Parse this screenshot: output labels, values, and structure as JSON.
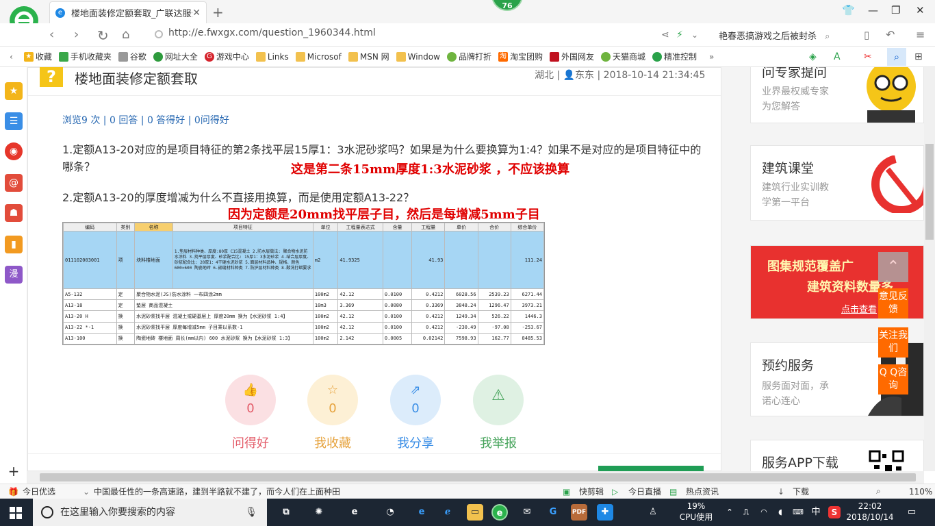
{
  "browser": {
    "tab_title": "楼地面装修定额套取_广联达服务",
    "notification_count": "76",
    "url": "http://e.fwxgx.com/question_1960344.html",
    "search_text": "艳春恶搞游戏之后被封杀"
  },
  "favorites": [
    {
      "label": "收藏",
      "icon": "star-icon",
      "color": "#f3b51a"
    },
    {
      "label": "手机收藏夹",
      "icon": "phone-icon",
      "color": "#3aa84a"
    },
    {
      "label": "谷歌",
      "icon": "page-icon",
      "color": "#999999"
    },
    {
      "label": "网址大全",
      "icon": "globe-icon",
      "color": "#2e9b3d"
    },
    {
      "label": "游戏中心",
      "icon": "game-icon",
      "color": "#d5232c"
    },
    {
      "label": "Links",
      "icon": "folder-icon",
      "color": "#f2c14e"
    },
    {
      "label": "Microsof",
      "icon": "folder-icon",
      "color": "#f2c14e"
    },
    {
      "label": "MSN 网",
      "icon": "folder-icon",
      "color": "#f2c14e"
    },
    {
      "label": "Window",
      "icon": "folder-icon",
      "color": "#f2c14e"
    },
    {
      "label": "品牌打折",
      "icon": "leaf-icon",
      "color": "#6fb43f"
    },
    {
      "label": "淘宝团购",
      "icon": "taobao-icon",
      "color": "#ff6a00"
    },
    {
      "label": "外国网友",
      "icon": "flag-icon",
      "color": "#c0111f"
    },
    {
      "label": "天猫商城",
      "icon": "leaf-icon",
      "color": "#6fb43f"
    },
    {
      "label": "精准控制",
      "icon": "chat-icon",
      "color": "#2aa24a"
    }
  ],
  "question": {
    "title": "楼地面装修定额套取",
    "meta": "湖北 | 👤东东 | 2018-10-14 21:34:45",
    "stats": "浏览9 次 | 0 回答 | 0 答得好 | 0问得好",
    "para1": "1.定额A13-20对应的是项目特征的第2条找平层15厚1：3水泥砂浆吗？如果是为什么要换算为1:4？如果不是对应的是项目特征中的哪条？",
    "annotation1": "这是第二条15mm厚度1:3水泥砂浆 ，不应该换算",
    "para2": "2.定额A13-20的厚度增减为什么不直接用换算，而是使用定额A13-22？",
    "annotation2": "因为定额是20mm找平层子目，然后是每增减5mm子目"
  },
  "table": {
    "headers": [
      "编码",
      "类别",
      "名称",
      "项目特征",
      "单位",
      "工程量表达式",
      "含量",
      "工程量",
      "单价",
      "合价",
      "综合单价"
    ],
    "rows": [
      [
        "011102003001",
        "项",
        "块料楼地面",
        "1.垫层材料种类、厚度:80厚 C15混凝土 2.防水层做法: 聚合物水泥防水涂料 3.找平层厚度、砂浆配合比: 15厚1：3水泥砂浆 4.结合层厚度、砂浆配合比: 20厚1：4干硬水泥砂浆 5.面层材料品种、规格、颜色 600×600 陶瓷地砖 6.嵌缝材料种类 7.防护层材料种类 8.酸洗打蜡要求",
        "m2",
        "41.9325",
        "",
        "41.93",
        "",
        "",
        "111.24"
      ],
      [
        "A5-132",
        "定",
        "聚合物水泥(JS)防水涂料 一布四涂2mm",
        "",
        "100m2",
        "42.12",
        "0.0100",
        "0.4212",
        "6028.56",
        "2539.23",
        "6271.44"
      ],
      [
        "A13-18",
        "定",
        "垫层 商品混凝土",
        "",
        "10m3",
        "3.369",
        "0.0080",
        "0.3369",
        "3848.24",
        "1296.47",
        "3973.21"
      ],
      [
        "A13-20 H",
        "换",
        "水泥砂浆找平层 混凝土或硬基层上 厚度20mm 换为【水泥砂浆 1:4】",
        "",
        "100m2",
        "42.12",
        "0.0100",
        "0.4212",
        "1249.34",
        "526.22",
        "1446.3"
      ],
      [
        "A13-22 *-1",
        "换",
        "水泥砂浆找平层 厚度每增减5mm 子目乘以系数-1",
        "",
        "100m2",
        "42.12",
        "0.0100",
        "0.4212",
        "-230.49",
        "-97.08",
        "-253.67"
      ],
      [
        "A13-100",
        "换",
        "陶瓷地砖 楼地面 周长(mm以内) 600 水泥砂浆 换为【水泥砂浆 1:3】",
        "",
        "100m2",
        "2.142",
        "0.0005",
        "0.02142",
        "7598.93",
        "162.77",
        "8485.53"
      ]
    ]
  },
  "actions": [
    {
      "count": "0",
      "label": "问得好",
      "icon": "thumbs-up-icon",
      "color": "#e35d6a",
      "bg": "#fbe0e3"
    },
    {
      "count": "0",
      "label": "我收藏",
      "icon": "star-icon",
      "color": "#e6a23c",
      "bg": "#fdf0d5"
    },
    {
      "count": "0",
      "label": "我分享",
      "icon": "share-icon",
      "color": "#3a8ee6",
      "bg": "#dcecfb"
    },
    {
      "count": "0",
      "label": "我举报",
      "icon": "warning-icon",
      "color": "#45a35a",
      "bg": "#dff1e3"
    }
  ],
  "right": {
    "expert": {
      "title": "问专家提问",
      "sub1": "业界最权威专家",
      "sub2": "为您解答"
    },
    "classroom": {
      "title": "建筑课堂",
      "sub1": "建筑行业实训教",
      "sub2": "学第一平台"
    },
    "banner": {
      "line1": "图集规范覆盖广",
      "line2": "建筑资料数量多",
      "link": "点击查看"
    },
    "booking": {
      "title": "预约服务",
      "sub1": "服务面对面，承",
      "sub2": "诺心连心"
    },
    "app": {
      "title": "服务APP下载"
    },
    "float": {
      "feedback": "意见反馈",
      "follow": "关注我们",
      "qq": "Q Q咨询"
    }
  },
  "statusbar": {
    "left": "今日优选",
    "news": "中国最任性的一条高速路，建到半路就不建了，而今人们在上面种田",
    "items": [
      "快剪辑",
      "今日直播",
      "热点资讯",
      "下载"
    ],
    "zoom": "110%"
  },
  "taskbar": {
    "search": "在这里输入你要搜索的内容",
    "cpu_pct": "19%",
    "cpu_label": "CPU使用",
    "ime": "中",
    "time": "22:02",
    "date": "2018/10/14"
  }
}
